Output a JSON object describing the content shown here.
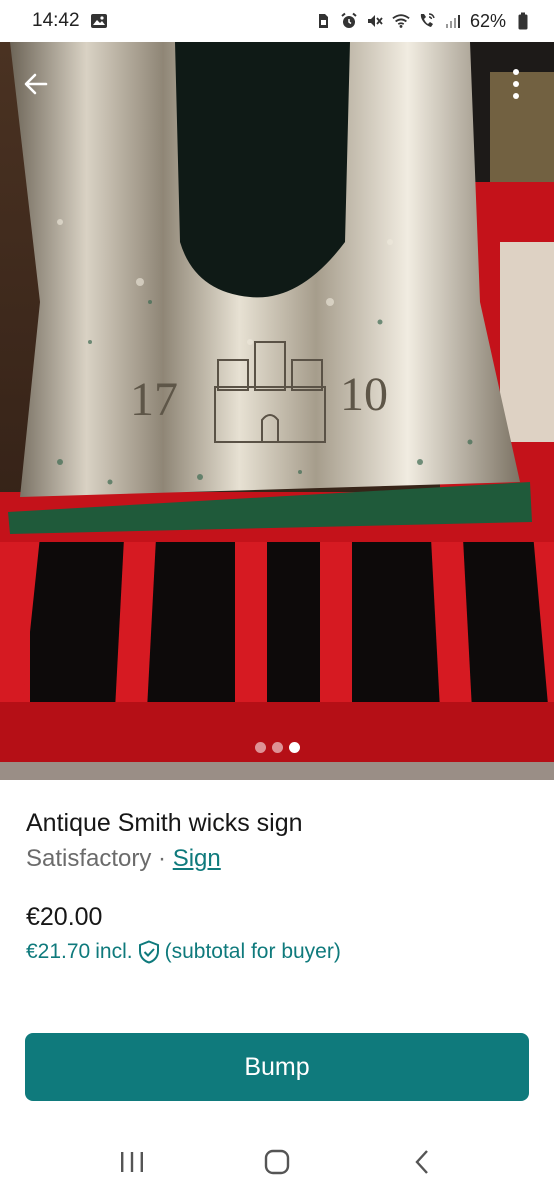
{
  "status_bar": {
    "time": "14:42",
    "battery": "62%",
    "icons": [
      "image-icon",
      "sim-icon",
      "alarm-icon",
      "mute-icon",
      "wifi-icon",
      "wifi-call-icon",
      "signal-icon",
      "battery-icon"
    ]
  },
  "photo": {
    "description_icon": "product-photo",
    "numerals_left": "17",
    "numerals_right": "10",
    "page_indicator": {
      "count": 3,
      "active_index": 2
    }
  },
  "toolbar": {
    "back_icon": "arrow-left-icon",
    "more_icon": "more-vertical-icon"
  },
  "item": {
    "title": "Antique Smith wicks sign",
    "condition": "Satisfactory",
    "separator": " · ",
    "brand_link": "Sign",
    "price": "€20.00",
    "buyer_price": "€21.70",
    "buyer_incl": "incl.",
    "buyer_note": "(subtotal for buyer)"
  },
  "actions": {
    "bump_label": "Bump"
  },
  "colors": {
    "accent": "#0f7a7c",
    "photo_red": "#c4121a",
    "photo_green": "#1f5a3a"
  }
}
